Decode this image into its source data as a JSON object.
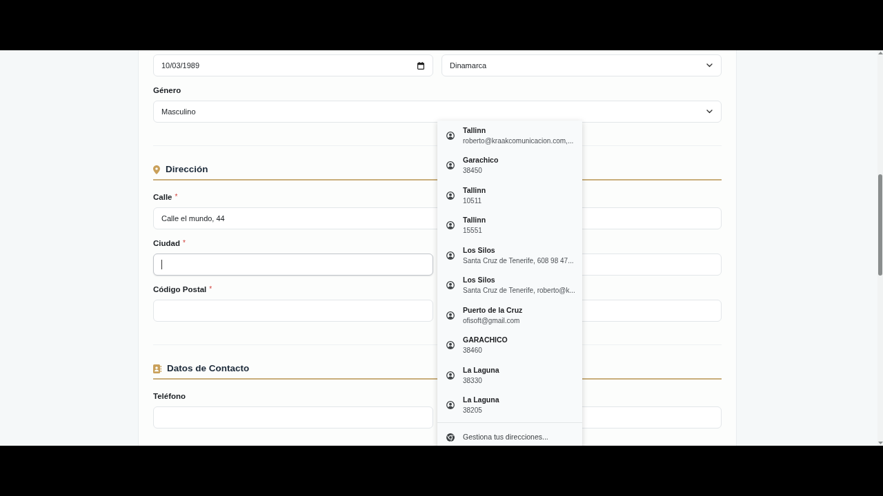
{
  "form": {
    "rows": [
      {
        "fields": [
          {
            "kind": "date",
            "value": "10/03/1989",
            "focused": false
          },
          {
            "kind": "select",
            "value": "Dinamarca",
            "focused": false
          }
        ]
      },
      {
        "fields": [
          {
            "kind": "select",
            "label": "Género",
            "value": "Masculino",
            "focused": false
          }
        ]
      }
    ],
    "sections": [
      {
        "kind": "address",
        "title": "Dirección",
        "rows": [
          {
            "fields": [
              {
                "kind": "text",
                "label": "Calle",
                "required_mark": "*",
                "value": "Calle el mundo, 44",
                "focused": false
              }
            ]
          },
          {
            "fields": [
              {
                "kind": "text",
                "label": "Ciudad",
                "required_mark": "*",
                "focused": true
              },
              {
                "kind": "text",
                "focused": false
              }
            ]
          },
          {
            "fields": [
              {
                "kind": "text",
                "label": "Código Postal",
                "required_mark": "*",
                "focused": false
              },
              {
                "kind": "text",
                "focused": false
              }
            ]
          }
        ]
      },
      {
        "kind": "contact",
        "title": "Datos de Contacto",
        "rows": [
          {
            "fields": [
              {
                "kind": "text",
                "label": "Teléfono",
                "focused": false
              },
              {
                "kind": "text",
                "focused": false
              }
            ]
          }
        ]
      }
    ]
  },
  "autofill_menu": {
    "suggestions": [
      {
        "title": "Tallinn",
        "detail": "roberto@kraakcomunicacion.com,...",
        "selected": false
      },
      {
        "title": "Garachico",
        "detail": "38450",
        "selected": false
      },
      {
        "title": "Tallinn",
        "detail": "10511",
        "selected": false
      },
      {
        "title": "Tallinn",
        "detail": "15551",
        "selected": false
      },
      {
        "title": "Los Silos",
        "detail": "Santa Cruz de Tenerife, 608 98 47...",
        "selected": false
      },
      {
        "title": "Los Silos",
        "detail": "Santa Cruz de Tenerife, roberto@k...",
        "selected": false
      },
      {
        "title": "Puerto de la Cruz",
        "detail": "ofisoft@gmail.com",
        "selected": false
      },
      {
        "title": "GARACHICO",
        "detail": "38460",
        "selected": false
      },
      {
        "title": "La Laguna",
        "detail": "38330",
        "selected": false
      },
      {
        "title": "La Laguna",
        "detail": "38205",
        "selected": false
      }
    ],
    "footer": "Gestiona tus direcciones..."
  }
}
